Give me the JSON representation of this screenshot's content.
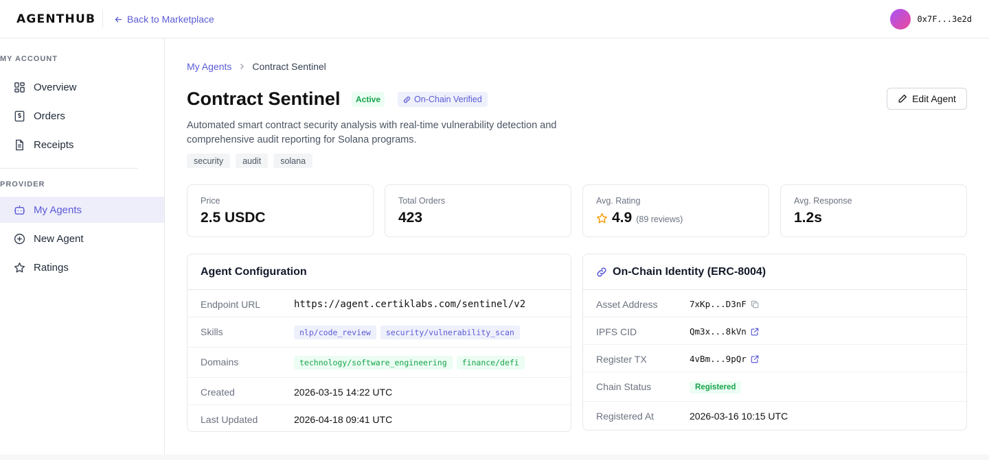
{
  "header": {
    "logo": "AGENTHUB",
    "back_label": "Back to Marketplace",
    "wallet_address": "0x7F...3e2d"
  },
  "sidebar": {
    "sections": [
      {
        "title": "MY ACCOUNT",
        "items": [
          {
            "label": "Overview",
            "icon": "grid-icon"
          },
          {
            "label": "Orders",
            "icon": "dollar-receipt-icon"
          },
          {
            "label": "Receipts",
            "icon": "document-icon"
          }
        ]
      },
      {
        "title": "PROVIDER",
        "items": [
          {
            "label": "My Agents",
            "icon": "robot-icon",
            "active": true
          },
          {
            "label": "New Agent",
            "icon": "plus-circle-icon"
          },
          {
            "label": "Ratings",
            "icon": "star-icon"
          }
        ]
      }
    ]
  },
  "breadcrumb": {
    "parent": "My Agents",
    "current": "Contract Sentinel"
  },
  "agent": {
    "name": "Contract Sentinel",
    "status": "Active",
    "verified_label": "On-Chain Verified",
    "edit_label": "Edit Agent",
    "description": "Automated smart contract security analysis with real-time vulnerability detection and comprehensive audit reporting for Solana programs.",
    "tags": [
      "security",
      "audit",
      "solana"
    ]
  },
  "stats": {
    "price": {
      "label": "Price",
      "value": "2.5 USDC"
    },
    "orders": {
      "label": "Total Orders",
      "value": "423"
    },
    "rating": {
      "label": "Avg. Rating",
      "value": "4.9",
      "sub": "(89 reviews)"
    },
    "response": {
      "label": "Avg. Response",
      "value": "1.2s"
    }
  },
  "config": {
    "title": "Agent Configuration",
    "endpoint_label": "Endpoint URL",
    "endpoint": "https://agent.certiklabs.com/sentinel/v2",
    "skills_label": "Skills",
    "skills": [
      "nlp/code_review",
      "security/vulnerability_scan"
    ],
    "domains_label": "Domains",
    "domains": [
      "technology/software_engineering",
      "finance/defi"
    ],
    "created_label": "Created",
    "created": "2026-03-15 14:22 UTC",
    "updated_label": "Last Updated",
    "updated": "2026-04-18 09:41 UTC"
  },
  "identity": {
    "title": "On-Chain Identity (ERC-8004)",
    "asset_label": "Asset Address",
    "asset": "7xKp...D3nF",
    "ipfs_label": "IPFS CID",
    "ipfs": "Qm3x...8kVn",
    "tx_label": "Register TX",
    "tx": "4vBm...9pQr",
    "status_label": "Chain Status",
    "status": "Registered",
    "registered_label": "Registered At",
    "registered": "2026-03-16 10:15 UTC"
  },
  "colors": {
    "accent": "#5b5bd6",
    "success": "#16a34a",
    "star": "#f59e0b"
  }
}
